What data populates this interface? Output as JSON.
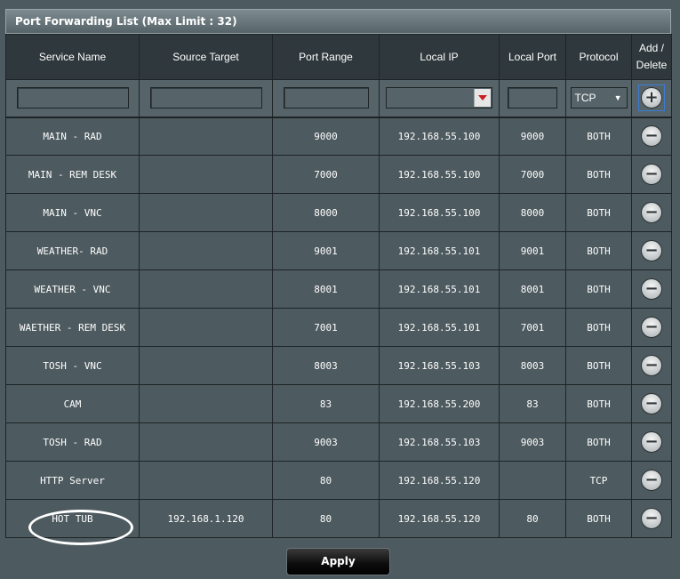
{
  "panel": {
    "title": "Port Forwarding List (Max Limit : 32)"
  },
  "columns": [
    "Service Name",
    "Source Target",
    "Port Range",
    "Local IP",
    "Local Port",
    "Protocol",
    "Add / Delete"
  ],
  "input_row": {
    "service_name": "",
    "source_target": "",
    "port_range": "",
    "local_ip": "",
    "local_port": "",
    "protocol": "TCP"
  },
  "rows": [
    {
      "service": "MAIN - RAD",
      "source": "",
      "port_range": "9000",
      "local_ip": "192.168.55.100",
      "local_port": "9000",
      "protocol": "BOTH"
    },
    {
      "service": "MAIN - REM DESK",
      "source": "",
      "port_range": "7000",
      "local_ip": "192.168.55.100",
      "local_port": "7000",
      "protocol": "BOTH"
    },
    {
      "service": "MAIN - VNC",
      "source": "",
      "port_range": "8000",
      "local_ip": "192.168.55.100",
      "local_port": "8000",
      "protocol": "BOTH"
    },
    {
      "service": "WEATHER- RAD",
      "source": "",
      "port_range": "9001",
      "local_ip": "192.168.55.101",
      "local_port": "9001",
      "protocol": "BOTH"
    },
    {
      "service": "WEATHER - VNC",
      "source": "",
      "port_range": "8001",
      "local_ip": "192.168.55.101",
      "local_port": "8001",
      "protocol": "BOTH"
    },
    {
      "service": "WAETHER - REM DESK",
      "source": "",
      "port_range": "7001",
      "local_ip": "192.168.55.101",
      "local_port": "7001",
      "protocol": "BOTH"
    },
    {
      "service": "TOSH - VNC",
      "source": "",
      "port_range": "8003",
      "local_ip": "192.168.55.103",
      "local_port": "8003",
      "protocol": "BOTH"
    },
    {
      "service": "CAM",
      "source": "",
      "port_range": "83",
      "local_ip": "192.168.55.200",
      "local_port": "83",
      "protocol": "BOTH"
    },
    {
      "service": "TOSH - RAD",
      "source": "",
      "port_range": "9003",
      "local_ip": "192.168.55.103",
      "local_port": "9003",
      "protocol": "BOTH"
    },
    {
      "service": "HTTP Server",
      "source": "",
      "port_range": "80",
      "local_ip": "192.168.55.120",
      "local_port": "",
      "protocol": "TCP"
    },
    {
      "service": "HOT TUB",
      "source": "192.168.1.120",
      "port_range": "80",
      "local_ip": "192.168.55.120",
      "local_port": "80",
      "protocol": "BOTH"
    }
  ],
  "icons": {
    "add": "plus-circle-icon",
    "delete": "minus-circle-icon",
    "dropdown": "chevron-down-icon"
  },
  "colors": {
    "background": "#4d5a5f",
    "header": "#2f383c",
    "input_row": "#56646a",
    "dropdown_arrow": "#c81f1f"
  },
  "apply_label": "Apply"
}
